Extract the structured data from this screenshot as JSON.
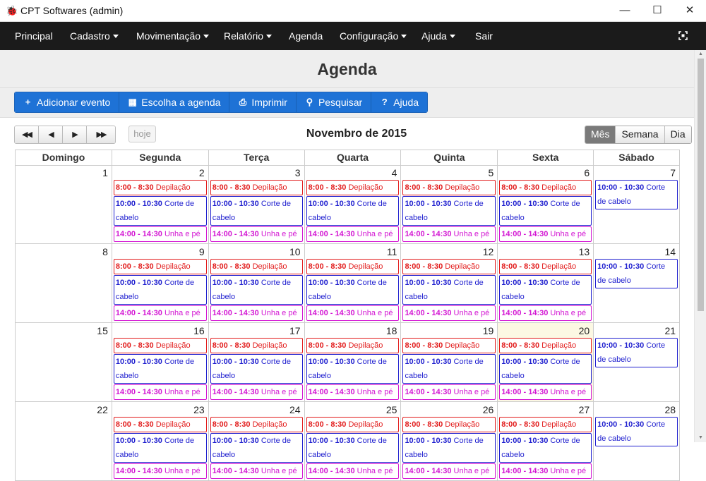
{
  "window": {
    "title": "CPT Softwares (admin)",
    "minimize": "—",
    "maximize": "☐",
    "close": "✕"
  },
  "nav": {
    "items": [
      {
        "label": "Principal"
      },
      {
        "label": "Cadastro",
        "dropdown": true
      },
      {
        "label": "Movimentação",
        "dropdown": true
      },
      {
        "label": "Relatório",
        "dropdown": true
      },
      {
        "label": "Agenda"
      },
      {
        "label": "Configuração",
        "dropdown": true
      },
      {
        "label": "Ajuda",
        "dropdown": true
      },
      {
        "label": "Sair"
      }
    ]
  },
  "page": {
    "title": "Agenda"
  },
  "toolbar": {
    "add_event": "Adicionar evento",
    "choose_agenda": "Escolha a agenda",
    "print": "Imprimir",
    "search": "Pesquisar",
    "help": "Ajuda"
  },
  "calendar": {
    "nav": {
      "prev_year": "◀◀",
      "prev": "◀",
      "next": "▶",
      "next_year": "▶▶"
    },
    "today": "hoje",
    "title": "Novembro de 2015",
    "views": {
      "month": "Mês",
      "week": "Semana",
      "day": "Dia",
      "active": "month"
    },
    "weekdays": [
      "Domingo",
      "Segunda",
      "Terça",
      "Quarta",
      "Quinta",
      "Sexta",
      "Sábado"
    ],
    "today_date": 20,
    "weeks": [
      [
        1,
        2,
        3,
        4,
        5,
        6,
        7
      ],
      [
        8,
        9,
        10,
        11,
        12,
        13,
        14
      ],
      [
        15,
        16,
        17,
        18,
        19,
        20,
        21
      ],
      [
        22,
        23,
        24,
        25,
        26,
        27,
        28
      ]
    ],
    "weekday_events": [
      {
        "time": "8:00 - 8:30",
        "title": "Depilação",
        "color": "#e21b1b"
      },
      {
        "time": "10:00 - 10:30",
        "title": "Corte de cabelo",
        "color": "#1f1fcf"
      },
      {
        "time": "14:00 - 14:30",
        "title": "Unha e pé",
        "color": "#d316d3"
      }
    ],
    "saturday_events": [
      {
        "time": "10:00 - 10:30",
        "title": "Corte de cabelo",
        "color": "#1f1fcf"
      }
    ]
  }
}
